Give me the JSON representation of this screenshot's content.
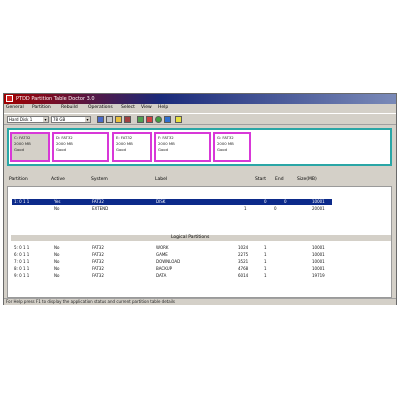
{
  "window": {
    "title": "PTDD Partition Table Doctor 3.0"
  },
  "menu": [
    "General",
    "Partition",
    "Rebuild",
    "Operations",
    "Select",
    "View",
    "Help"
  ],
  "toolbar": {
    "disk_select": "Hard Disk 1",
    "size_select": "78 GB"
  },
  "partitions": [
    {
      "lines": [
        "C: FAT32",
        "2000 MB",
        "Good"
      ]
    },
    {
      "lines": [
        "D: FAT32",
        "2000 MB",
        "Good"
      ]
    },
    {
      "lines": [
        "E: FAT32",
        "2000 MB",
        "Good"
      ]
    },
    {
      "lines": [
        "F: FAT32",
        "2000 MB",
        "Good"
      ]
    },
    {
      "lines": [
        "G: FAT32",
        "2000 MB",
        "Good"
      ]
    }
  ],
  "columns": {
    "part": "Partition",
    "active": "Active",
    "system": "System",
    "label": "Label",
    "start": "Start",
    "end": "End",
    "size": "Size(MB)"
  },
  "primary_rows": [
    {
      "part": "1: 0 1 1",
      "active": "Yes",
      "system": "FAT32",
      "label": "DISK",
      "start": "0",
      "end": "0",
      "size": "10001"
    },
    {
      "part": "",
      "active": "No",
      "system": "EXTEND",
      "label": "",
      "start": "1",
      "end": "0",
      "size": "20001"
    }
  ],
  "logical": {
    "title": "Logical Partitions",
    "rows": [
      {
        "part": "5: 0 1 1",
        "active": "No",
        "system": "FAT32",
        "label": "WORK",
        "start": "1024",
        "end": "1",
        "size": "10001"
      },
      {
        "part": "6: 0 1 1",
        "active": "No",
        "system": "FAT32",
        "label": "GAME",
        "start": "2275",
        "end": "1",
        "size": "10001"
      },
      {
        "part": "7: 0 1 1",
        "active": "No",
        "system": "FAT32",
        "label": "DOWNLOAD",
        "start": "3521",
        "end": "1",
        "size": "10001"
      },
      {
        "part": "8: 0 1 1",
        "active": "No",
        "system": "FAT32",
        "label": "BACKUP",
        "start": "4768",
        "end": "1",
        "size": "10001"
      },
      {
        "part": "9: 0 1 1",
        "active": "No",
        "system": "FAT32",
        "label": "DATA",
        "start": "6014",
        "end": "1",
        "size": "19719"
      }
    ]
  },
  "status": "For Help press F1 to display the application status and current partition table details"
}
